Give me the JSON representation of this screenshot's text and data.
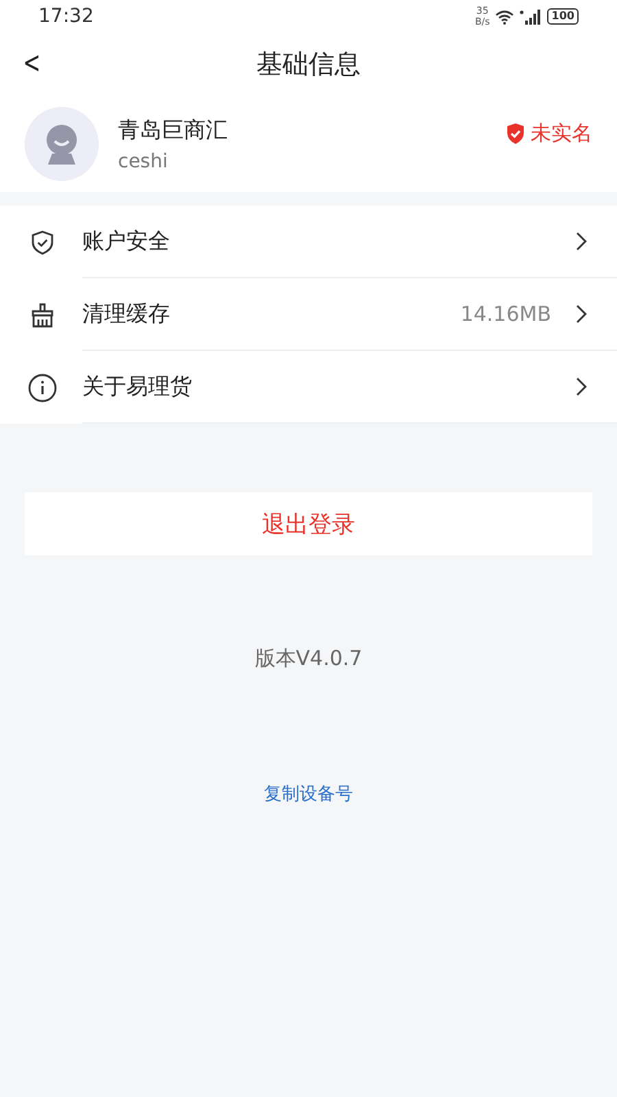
{
  "status_bar": {
    "time": "17:32",
    "net_speed": "35",
    "net_unit": "B/s",
    "battery": "100"
  },
  "header": {
    "back": "<",
    "title": "基础信息"
  },
  "profile": {
    "name": "青岛巨商汇",
    "account": "ceshi",
    "verify_badge": "未实名"
  },
  "menu": [
    {
      "kind": "security",
      "label": "账户安全"
    },
    {
      "kind": "cache",
      "label": "清理缓存",
      "value": "14.16MB"
    },
    {
      "kind": "about",
      "label": "关于易理货"
    }
  ],
  "logout": "退出登录",
  "version": "版本V4.0.7",
  "copy_device": "复制设备号"
}
